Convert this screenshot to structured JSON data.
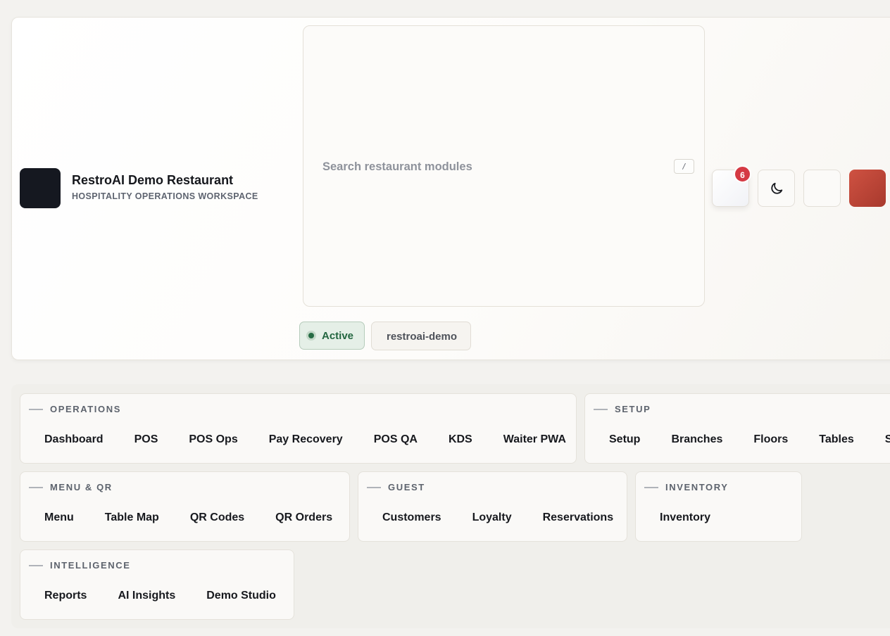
{
  "brand": {
    "name": "RestroAI Demo Restaurant",
    "subtitle": "HOSPITALITY OPERATIONS WORKSPACE"
  },
  "search": {
    "placeholder": "Search restaurant modules",
    "shortcut": "/"
  },
  "toolbar": {
    "notification_count": "6",
    "notification_icon": "bell-icon",
    "theme_icon": "moon-icon",
    "badge_color": "#d53a44",
    "avatar_color": "#c0483a"
  },
  "status": {
    "label": "Active",
    "color": "#266b44",
    "slug": "restroai-demo"
  },
  "nav": {
    "operations": {
      "title": "OPERATIONS",
      "items": [
        "Dashboard",
        "POS",
        "POS Ops",
        "Pay Recovery",
        "POS QA",
        "KDS",
        "Waiter PWA"
      ]
    },
    "setup": {
      "title": "SETUP",
      "items": [
        "Setup",
        "Branches",
        "Floors",
        "Tables",
        "St"
      ]
    },
    "menu_qr": {
      "title": "MENU & QR",
      "items": [
        "Menu",
        "Table Map",
        "QR Codes",
        "QR Orders"
      ]
    },
    "guest": {
      "title": "GUEST",
      "items": [
        "Customers",
        "Loyalty",
        "Reservations"
      ]
    },
    "inventory": {
      "title": "INVENTORY",
      "items": [
        "Inventory"
      ]
    },
    "intelligence": {
      "title": "INTELLIGENCE",
      "items": [
        "Reports",
        "AI Insights",
        "Demo Studio"
      ]
    }
  }
}
